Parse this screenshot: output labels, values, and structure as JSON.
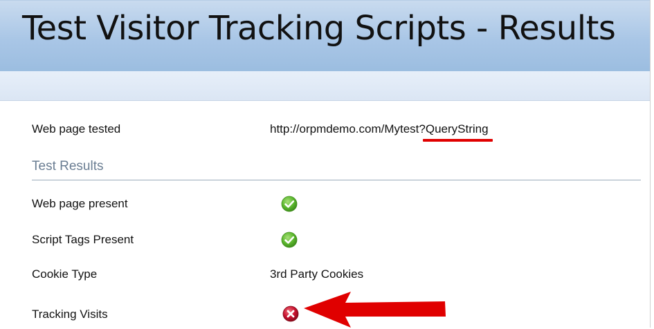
{
  "header": {
    "title": "Test Visitor Tracking Scripts - Results",
    "colors": {
      "top": "#c9dbef",
      "bottom": "#9bbde0"
    }
  },
  "details": {
    "web_page_tested": {
      "label": "Web page tested",
      "url_base": "http://orpmdemo.com/Mytest?",
      "url_query": "QueryString"
    }
  },
  "results": {
    "heading": "Test Results",
    "rows": [
      {
        "label": "Web page present",
        "status": "pass",
        "icon": "check-circle-icon"
      },
      {
        "label": "Script Tags Present",
        "status": "pass",
        "icon": "check-circle-icon"
      },
      {
        "label": "Cookie Type",
        "value": "3rd Party Cookies"
      },
      {
        "label": "Tracking Visits",
        "status": "fail",
        "icon": "x-circle-icon"
      }
    ]
  },
  "annotations": {
    "underline_color": "#e00000",
    "arrow_color": "#e00000",
    "arrow_icon": "red-arrow-left-icon"
  },
  "status_colors": {
    "pass": "#5cb82e",
    "fail": "#c8102e"
  }
}
